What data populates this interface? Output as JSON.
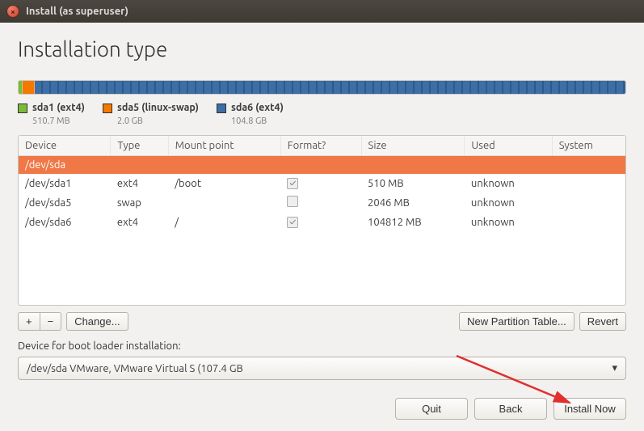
{
  "titlebar": {
    "title": "Install (as superuser)"
  },
  "header": {
    "title": "Installation type"
  },
  "partition_bar": {
    "segments": [
      {
        "class": "s1",
        "pct": 0.7
      },
      {
        "class": "s2",
        "pct": 2.0
      },
      {
        "class": "s3",
        "pct": 97.3
      }
    ]
  },
  "legend": [
    {
      "color": "g",
      "name": "sda1 (ext4)",
      "size": "510.7 MB"
    },
    {
      "color": "o",
      "name": "sda5 (linux-swap)",
      "size": "2.0 GB"
    },
    {
      "color": "b",
      "name": "sda6 (ext4)",
      "size": "104.8 GB"
    }
  ],
  "table": {
    "headers": [
      "Device",
      "Type",
      "Mount point",
      "Format?",
      "Size",
      "Used",
      "System"
    ],
    "rows": [
      {
        "sel": true,
        "cells": [
          "/dev/sda",
          "",
          "",
          "",
          "",
          "",
          ""
        ]
      },
      {
        "sel": false,
        "cells": [
          "/dev/sda1",
          "ext4",
          "/boot",
          "on",
          "510 MB",
          "unknown",
          ""
        ]
      },
      {
        "sel": false,
        "cells": [
          "/dev/sda5",
          "swap",
          "",
          "off",
          "2046 MB",
          "unknown",
          ""
        ]
      },
      {
        "sel": false,
        "cells": [
          "/dev/sda6",
          "ext4",
          "/",
          "on",
          "104812 MB",
          "unknown",
          ""
        ]
      }
    ]
  },
  "toolbar": {
    "add": "+",
    "remove": "−",
    "change": "Change...",
    "new_table": "New Partition Table...",
    "revert": "Revert"
  },
  "bootloader": {
    "label": "Device for boot loader installation:",
    "value": "/dev/sda   VMware, VMware Virtual S (107.4 GB"
  },
  "footer": {
    "quit": "Quit",
    "back": "Back",
    "install": "Install Now"
  }
}
